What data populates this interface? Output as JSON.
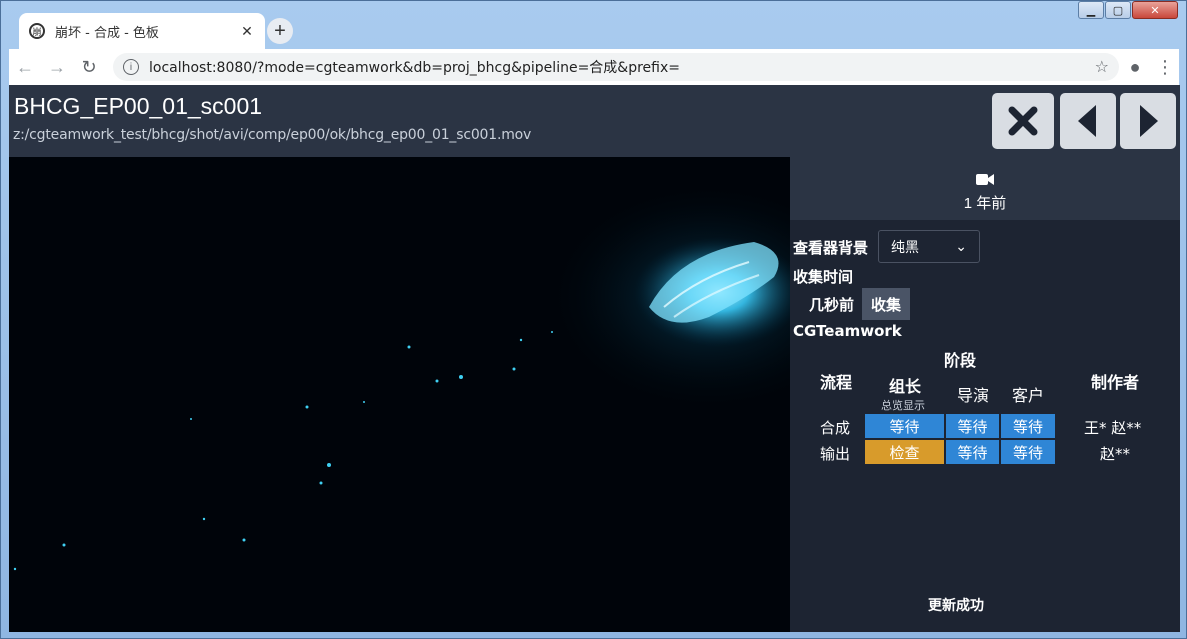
{
  "browser": {
    "tab_title": "崩坏 - 合成 - 色板",
    "tab_favicon": "崩",
    "url": "localhost:8080/?mode=cgteamwork&db=proj_bhcg&pipeline=合成&prefix="
  },
  "header": {
    "shot_name": "BHCG_EP00_01_sc001",
    "file_path": "z:/cgteamwork_test/bhcg/shot/avi/comp/ep00/ok/bhcg_ep00_01_sc001.mov"
  },
  "side": {
    "time_ago": "1 年前",
    "viewer_bg_label": "查看器背景",
    "viewer_bg_value": "纯黑",
    "collect_time_label": "收集时间",
    "collect_time_value": "几秒前",
    "collect_button": "收集",
    "source_label": "CGTeamwork",
    "table": {
      "stage_header": "阶段",
      "pipeline_header": "流程",
      "lead_header": "组长",
      "lead_sub": "总览显示",
      "director_header": "导演",
      "client_header": "客户",
      "maker_header": "制作者",
      "rows": [
        {
          "pipeline": "合成",
          "lead": "等待",
          "director": "等待",
          "client": "等待",
          "maker": "王*  赵**"
        },
        {
          "pipeline": "输出",
          "lead": "检查",
          "director": "等待",
          "client": "等待",
          "maker": "赵**"
        }
      ]
    },
    "status_message": "更新成功"
  },
  "colors": {
    "wait": "#2f86d6",
    "check": "#d89b2b",
    "header_bg": "#2b3444",
    "panel_bg": "#1d2432"
  }
}
